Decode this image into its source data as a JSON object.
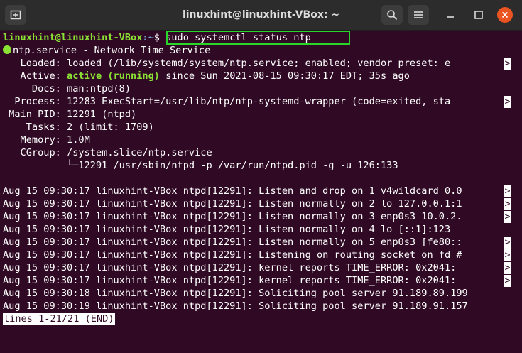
{
  "window": {
    "title": "linuxhint@linuxhint-VBox: ~"
  },
  "icons": {
    "new_tab": "new-tab-icon",
    "search": "search-icon",
    "menu": "hamburger-menu-icon",
    "minimize": "minimize-icon",
    "maximize": "maximize-icon",
    "close": "close-icon"
  },
  "prompt": {
    "user_host": "linuxhint@linuxhint-VBox",
    "path": ":~",
    "command": "$ sudo systemctl status ntp"
  },
  "status": {
    "service": "ntp.service - Network Time Service",
    "loaded": "   Loaded: loaded (/lib/systemd/system/ntp.service; enabled; vendor preset: e",
    "active_label": "   Active: ",
    "active_state": "active (running)",
    "active_rest": " since Sun 2021-08-15 09:30:17 EDT; 35s ago",
    "docs": "     Docs: man:ntpd(8)",
    "process": "  Process: 12283 ExecStart=/usr/lib/ntp/ntp-systemd-wrapper (code=exited, sta",
    "main_pid": " Main PID: 12291 (ntpd)",
    "tasks": "    Tasks: 2 (limit: 1709)",
    "memory": "   Memory: 1.0M",
    "cgroup": "   CGroup: /system.slice/ntp.service",
    "cgroup_child": "           └─12291 /usr/sbin/ntpd -p /var/run/ntpd.pid -g -u 126:133"
  },
  "logs": [
    "Aug 15 09:30:17 linuxhint-VBox ntpd[12291]: Listen and drop on 1 v4wildcard 0.0",
    "Aug 15 09:30:17 linuxhint-VBox ntpd[12291]: Listen normally on 2 lo 127.0.0.1:1",
    "Aug 15 09:30:17 linuxhint-VBox ntpd[12291]: Listen normally on 3 enp0s3 10.0.2.",
    "Aug 15 09:30:17 linuxhint-VBox ntpd[12291]: Listen normally on 4 lo [::1]:123",
    "Aug 15 09:30:17 linuxhint-VBox ntpd[12291]: Listen normally on 5 enp0s3 [fe80::",
    "Aug 15 09:30:17 linuxhint-VBox ntpd[12291]: Listening on routing socket on fd #",
    "Aug 15 09:30:17 linuxhint-VBox ntpd[12291]: kernel reports TIME_ERROR: 0x2041: ",
    "Aug 15 09:30:17 linuxhint-VBox ntpd[12291]: kernel reports TIME_ERROR: 0x2041: ",
    "Aug 15 09:30:18 linuxhint-VBox ntpd[12291]: Soliciting pool server 91.189.89.199",
    "Aug 15 09:30:19 linuxhint-VBox ntpd[12291]: Soliciting pool server 91.189.91.157"
  ],
  "truncation_marker": ">",
  "pager_status": "lines 1-21/21 (END)"
}
